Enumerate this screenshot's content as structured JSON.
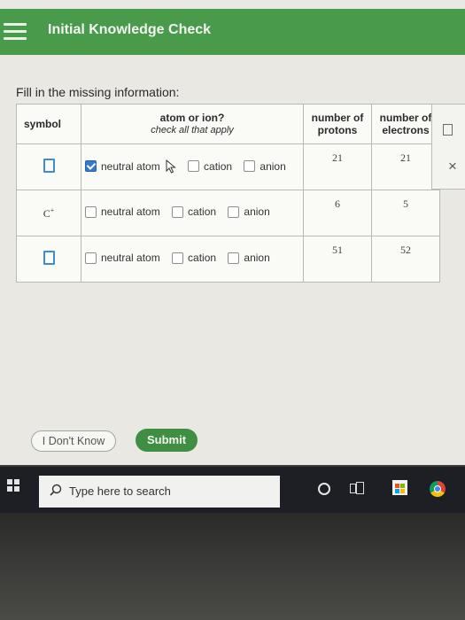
{
  "header": {
    "title": "Initial Knowledge Check"
  },
  "question": {
    "prompt": "Fill in the missing information:",
    "columns": {
      "symbol": "symbol",
      "atom_or_ion": "atom or ion?",
      "atom_or_ion_sub": "check all that apply",
      "protons_line1": "number of",
      "protons_line2": "protons",
      "electrons_line1": "number of",
      "electrons_line2": "electrons"
    },
    "option_labels": {
      "neutral": "neutral atom",
      "cation": "cation",
      "anion": "anion"
    },
    "rows": [
      {
        "symbol": "",
        "neutral_checked": true,
        "cation_checked": false,
        "anion_checked": false,
        "protons": "21",
        "electrons": "21"
      },
      {
        "symbol": "C",
        "symbol_charge": "+",
        "neutral_checked": false,
        "cation_checked": false,
        "anion_checked": false,
        "protons": "6",
        "electrons": "5"
      },
      {
        "symbol": "",
        "neutral_checked": false,
        "cation_checked": false,
        "anion_checked": false,
        "protons": "51",
        "electrons": "52"
      }
    ]
  },
  "side_panel": {
    "close_glyph": "×"
  },
  "buttons": {
    "dont_know": "I Don't Know",
    "submit": "Submit"
  },
  "taskbar": {
    "search_placeholder": "Type here to search"
  },
  "colors": {
    "header_green": "#4a9a4c",
    "submit_green": "#3f8e43",
    "checkbox_blue": "#3377d0"
  }
}
